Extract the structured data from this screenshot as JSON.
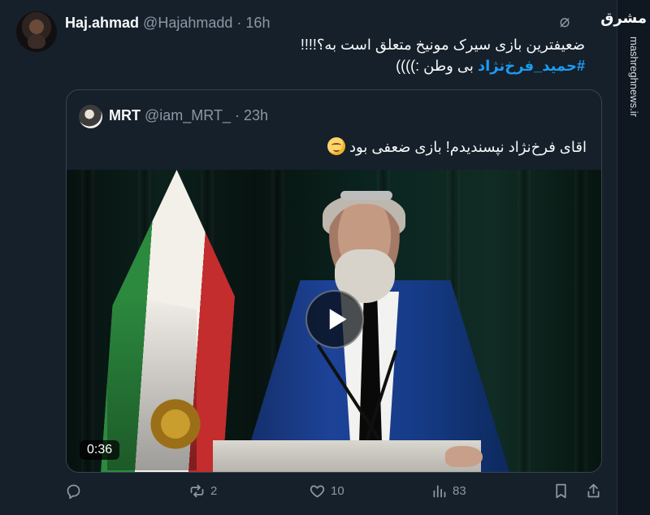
{
  "tweet": {
    "author_name": "Haj.ahmad",
    "author_handle": "@Hajahmadd",
    "separator": "·",
    "time": "16h",
    "line1": "ضعیفترین بازی سیرک مونیخ متعلق است به؟!!!!",
    "hashtag": "#حمید_فرخ‌نژاد",
    "line2_suffix": " بی وطن :))))"
  },
  "quote": {
    "author_name": "MRT",
    "author_handle": "@iam_MRT_",
    "separator": "·",
    "time": "23h",
    "text": "اقای فرخ‌نژاد نپسندیدم! بازی ضعفی بود",
    "emoji": "relieved-face-emoji",
    "video_duration": "0:36"
  },
  "actions": {
    "reposts": "2",
    "likes": "10",
    "views": "83"
  },
  "watermark": {
    "logo_text": "مشرق",
    "site": "mashreghnews.ir"
  },
  "colors": {
    "background": "#15202b",
    "text": "#f7f9f9",
    "muted": "#8b98a5",
    "link": "#1d9bf0",
    "border": "#38444d"
  },
  "icons": {
    "grok": "grok-icon",
    "reply": "reply-icon",
    "repost": "repost-icon",
    "like": "heart-icon",
    "views": "views-chart-icon",
    "bookmark": "bookmark-icon",
    "share": "share-icon",
    "play": "play-icon"
  }
}
